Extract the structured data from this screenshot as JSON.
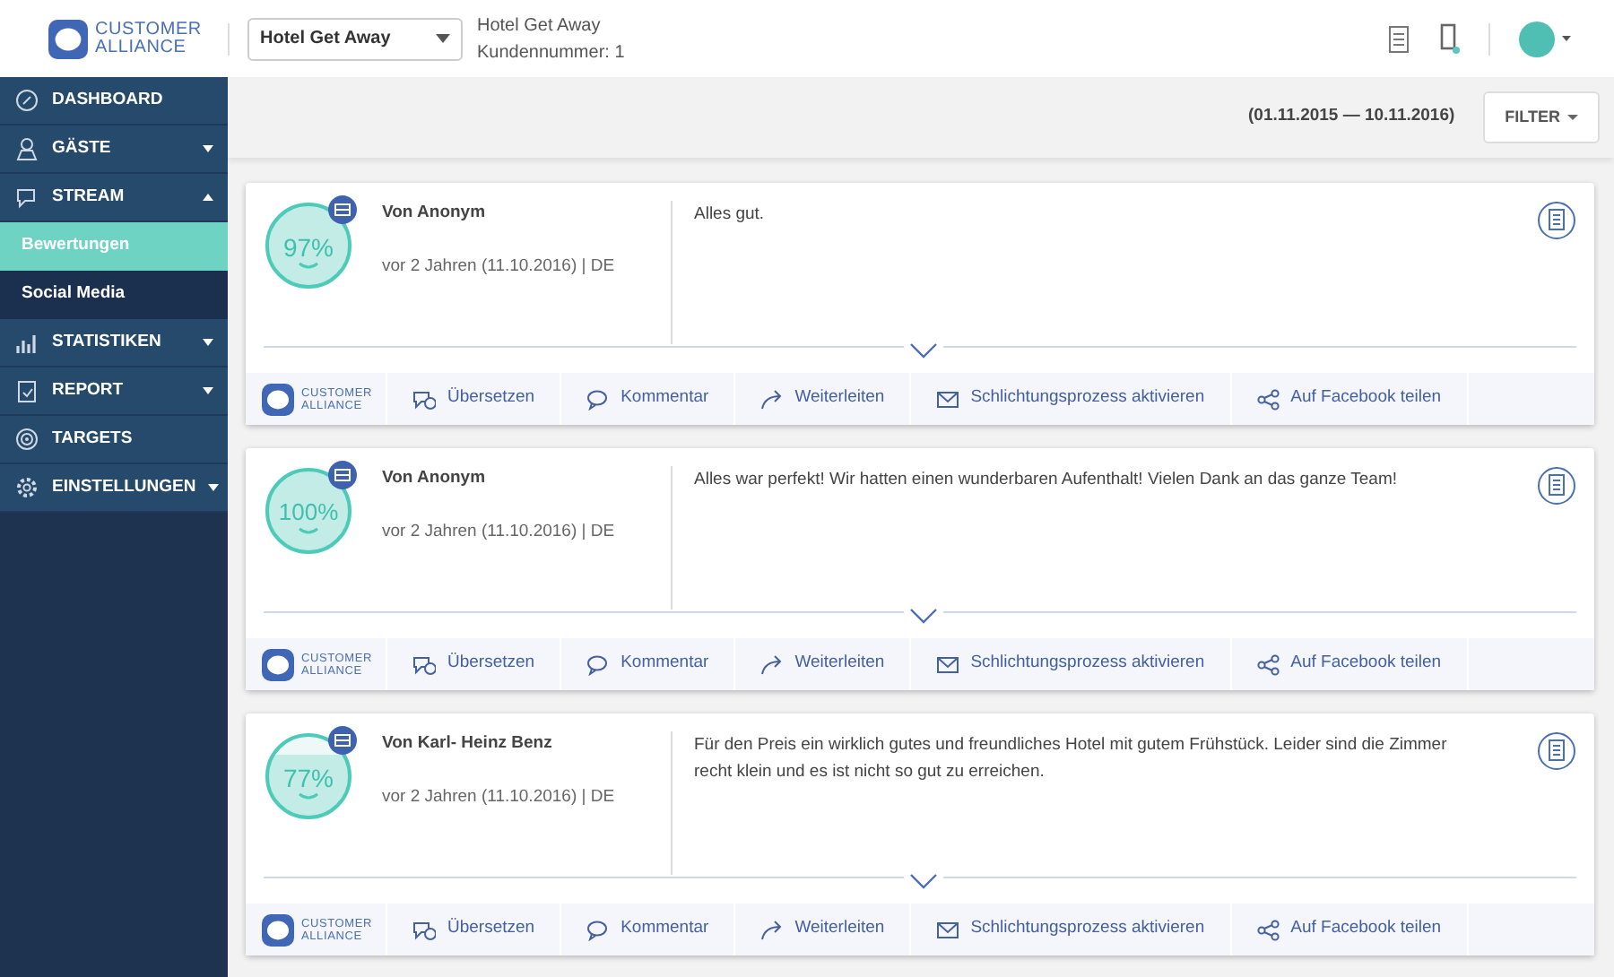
{
  "header": {
    "logo": [
      "CUSTOMER",
      "ALLIANCE"
    ],
    "hotel_select": "Hotel Get Away",
    "hotel_name": "Hotel Get Away",
    "customer_number": "Kundennummer: 1",
    "notification": true
  },
  "sidebar": {
    "items": [
      {
        "label": "DASHBOARD"
      },
      {
        "label": "GÄSTE",
        "expanded": false
      },
      {
        "label": "STREAM",
        "expanded": true,
        "children": [
          {
            "label": "Bewertungen",
            "selected": true
          },
          {
            "label": "Social Media",
            "selected": false
          }
        ]
      },
      {
        "label": "STATISTIKEN",
        "expanded": false
      },
      {
        "label": "REPORT",
        "expanded": false
      },
      {
        "label": "TARGETS"
      },
      {
        "label": "EINSTELLUNGEN",
        "expanded": false
      }
    ]
  },
  "toolbar": {
    "date_range": "(01.11.2015 — 10.11.2016)",
    "filter_button": "FILTER"
  },
  "reviews": [
    {
      "score": "97%",
      "level": 0.97,
      "author": "Von Anonym",
      "meta": "vor 2 Jahren (11.10.2016) | DE",
      "text": "Alles gut.",
      "footer_logo": [
        "CUSTOMER",
        "ALLIANCE"
      ],
      "actions": [
        "Übersetzen",
        "Kommentar",
        "Weiterleiten",
        "Schlichtungsprozess aktivieren",
        "Auf Facebook teilen"
      ]
    },
    {
      "score": "100%",
      "level": 1,
      "author": "Von Anonym",
      "meta": "vor 2 Jahren (11.10.2016) | DE",
      "text": "Alles war perfekt! Wir hatten einen wunderbaren Aufenthalt! Vielen Dank an das ganze Team!",
      "footer_logo": [
        "CUSTOMER",
        "ALLIANCE"
      ],
      "actions": [
        "Übersetzen",
        "Kommentar",
        "Weiterleiten",
        "Schlichtungsprozess aktivieren",
        "Auf Facebook teilen"
      ]
    },
    {
      "score": "77%",
      "level": 0.77,
      "author": "Von Karl- Heinz Benz",
      "meta": "vor 2 Jahren (11.10.2016) | DE",
      "text": "Für den Preis ein wirklich gutes und freundliches Hotel mit gutem Frühstück. Leider sind die Zimmer recht klein und es ist nicht so gut zu erreichen.",
      "footer_logo": [
        "CUSTOMER",
        "ALLIANCE"
      ],
      "actions": [
        "Übersetzen",
        "Kommentar",
        "Weiterleiten",
        "Schlichtungsprozess aktivieren",
        "Auf Facebook teilen"
      ]
    }
  ]
}
